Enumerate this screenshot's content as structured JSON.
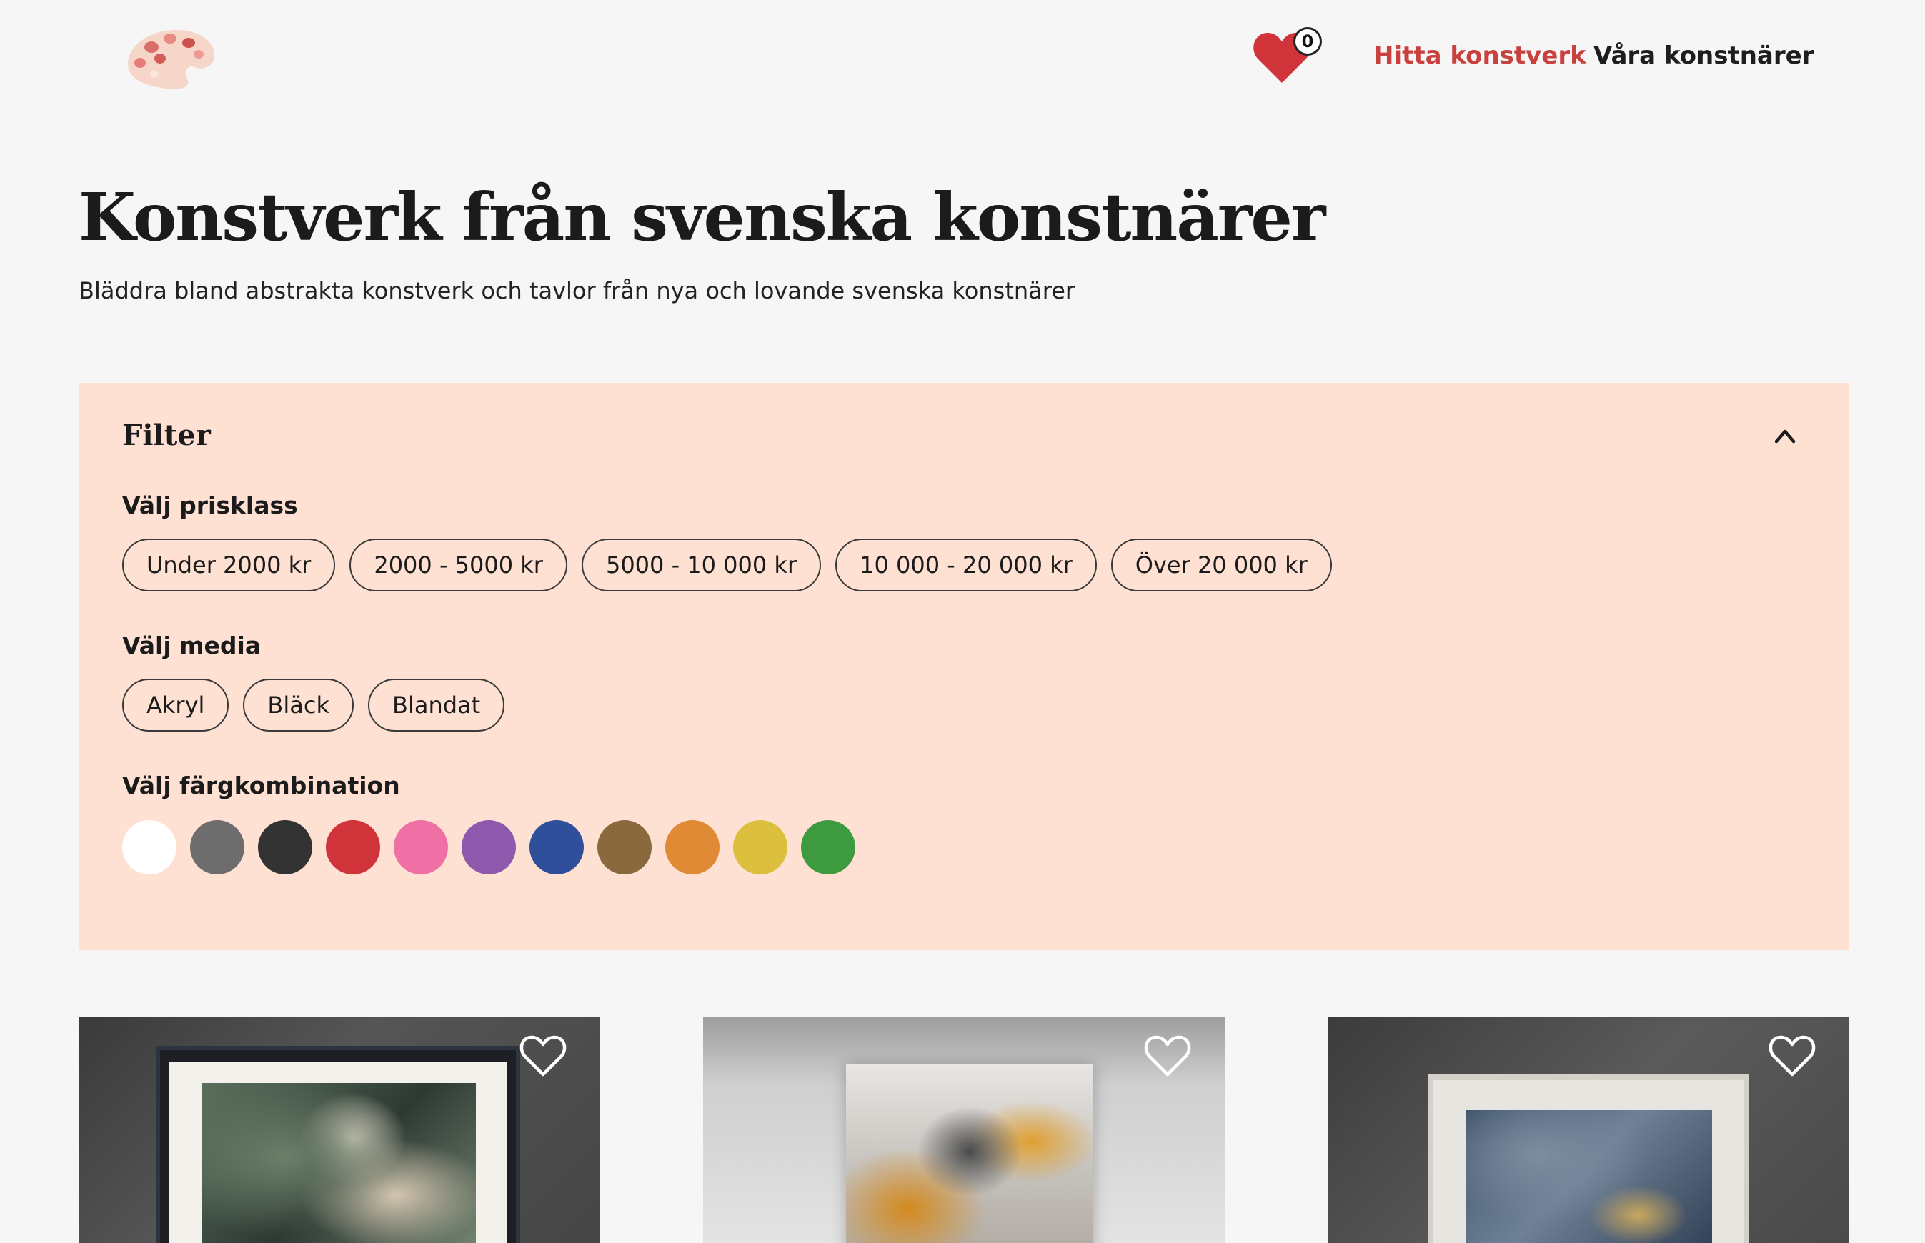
{
  "header": {
    "logo_icon": "palette-icon",
    "wishlist_icon": "heart-icon",
    "wishlist_count": "0",
    "nav": [
      {
        "label": "Hitta konstverk",
        "active": true
      },
      {
        "label": "Våra konstnärer",
        "active": false
      }
    ]
  },
  "page": {
    "title": "Konstverk från svenska konstnärer",
    "subtitle": "Bläddra bland abstrakta konstverk och tavlor från nya och lovande svenska konstnärer"
  },
  "filter": {
    "title": "Filter",
    "collapse_icon": "chevron-up-icon",
    "price": {
      "label": "Välj prisklass",
      "options": [
        "Under 2000 kr",
        "2000 - 5000 kr",
        "5000 - 10 000 kr",
        "10 000 - 20 000 kr",
        "Över 20 000 kr"
      ]
    },
    "media": {
      "label": "Välj media",
      "options": [
        "Akryl",
        "Bläck",
        "Blandat"
      ]
    },
    "colors": {
      "label": "Välj färgkombination",
      "swatches": [
        "#ffffff",
        "#6d6d6d",
        "#333333",
        "#d0333a",
        "#ee70a5",
        "#8e58ad",
        "#2f4f9a",
        "#8a6a3c",
        "#e08a35",
        "#dcbf3c",
        "#3d9a3f"
      ]
    }
  },
  "artworks": [
    {
      "favorite_icon": "heart-outline-icon"
    },
    {
      "favorite_icon": "heart-outline-icon"
    },
    {
      "favorite_icon": "heart-outline-icon"
    }
  ],
  "colors": {
    "background": "#f6f6f6",
    "filter_background": "#ffe1d3",
    "accent": "#c9413e",
    "text": "#1b1b1b"
  }
}
